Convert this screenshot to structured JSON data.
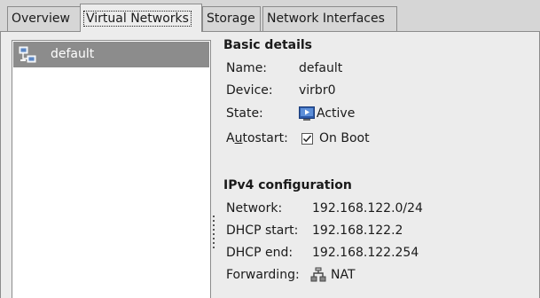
{
  "tabs": [
    {
      "label": "Overview"
    },
    {
      "label": "Virtual Networks",
      "active": true
    },
    {
      "label": "Storage"
    },
    {
      "label": "Network Interfaces"
    }
  ],
  "network_list": {
    "items": [
      {
        "label": "default",
        "icon": "network-icon",
        "selected": true
      }
    ]
  },
  "basic": {
    "title": "Basic details",
    "name_label": "Name:",
    "name_value": "default",
    "device_label": "Device:",
    "device_value": "virbr0",
    "state_label": "State:",
    "state_icon": "running-icon",
    "state_value": "Active",
    "autostart_label_pre": "A",
    "autostart_label_ul": "u",
    "autostart_label_post": "tostart:",
    "autostart_checked": true,
    "autostart_value": "On Boot"
  },
  "ipv4": {
    "title": "IPv4 configuration",
    "network_label": "Network:",
    "network_value": "192.168.122.0/24",
    "dhcp_start_label": "DHCP start:",
    "dhcp_start_value": "192.168.122.2",
    "dhcp_end_label": "DHCP end:",
    "dhcp_end_value": "192.168.122.254",
    "forwarding_label": "Forwarding:",
    "forwarding_icon": "nat-icon",
    "forwarding_value": "NAT"
  },
  "colors": {
    "selection": "#8c8c8c",
    "background": "#ececec",
    "tabbar": "#d6d6d6"
  }
}
